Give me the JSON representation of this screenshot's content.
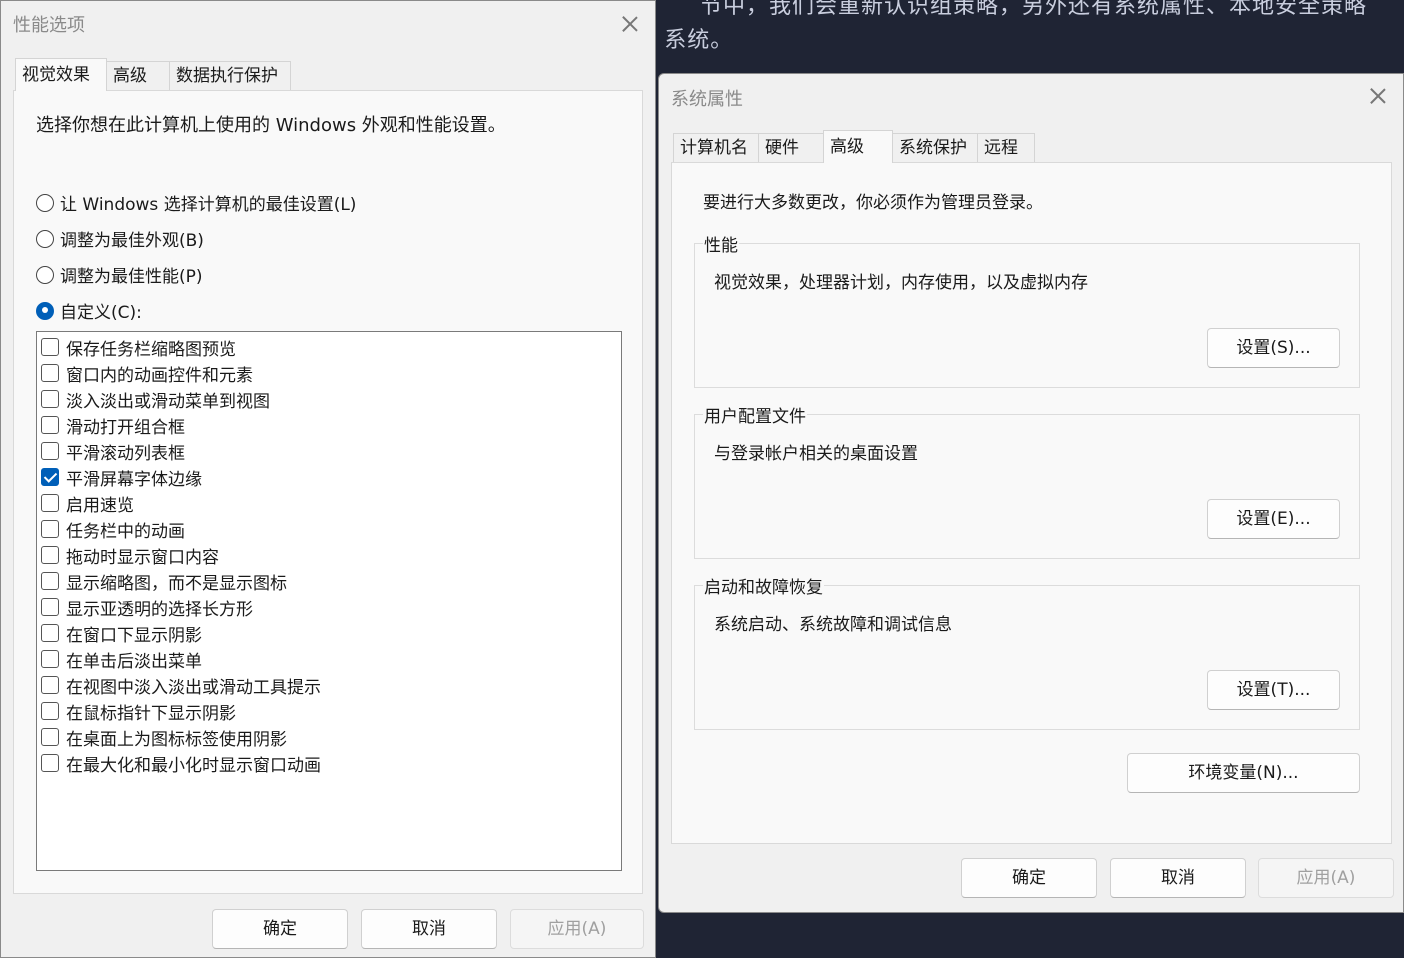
{
  "background": {
    "line1": "节中，我们会重新认识组策略，另外还有系统属性、本地安全策略",
    "line2": "s 系统。"
  },
  "perf": {
    "title": "性能选项",
    "tabs": [
      "视觉效果",
      "高级",
      "数据执行保护"
    ],
    "description": "选择你想在此计算机上使用的 Windows 外观和性能设置。",
    "radios": [
      {
        "label": "让 Windows 选择计算机的最佳设置(L)",
        "checked": false
      },
      {
        "label": "调整为最佳外观(B)",
        "checked": false
      },
      {
        "label": "调整为最佳性能(P)",
        "checked": false
      },
      {
        "label": "自定义(C):",
        "checked": true
      }
    ],
    "options": [
      {
        "label": "保存任务栏缩略图预览",
        "checked": false
      },
      {
        "label": "窗口内的动画控件和元素",
        "checked": false
      },
      {
        "label": "淡入淡出或滑动菜单到视图",
        "checked": false
      },
      {
        "label": "滑动打开组合框",
        "checked": false
      },
      {
        "label": "平滑滚动列表框",
        "checked": false
      },
      {
        "label": "平滑屏幕字体边缘",
        "checked": true
      },
      {
        "label": "启用速览",
        "checked": false
      },
      {
        "label": "任务栏中的动画",
        "checked": false
      },
      {
        "label": "拖动时显示窗口内容",
        "checked": false
      },
      {
        "label": "显示缩略图，而不是显示图标",
        "checked": false
      },
      {
        "label": "显示亚透明的选择长方形",
        "checked": false
      },
      {
        "label": "在窗口下显示阴影",
        "checked": false
      },
      {
        "label": "在单击后淡出菜单",
        "checked": false
      },
      {
        "label": "在视图中淡入淡出或滑动工具提示",
        "checked": false
      },
      {
        "label": "在鼠标指针下显示阴影",
        "checked": false
      },
      {
        "label": "在桌面上为图标标签使用阴影",
        "checked": false
      },
      {
        "label": "在最大化和最小化时显示窗口动画",
        "checked": false
      }
    ],
    "ok": "确定",
    "cancel": "取消",
    "apply": "应用(A)"
  },
  "sys": {
    "title": "系统属性",
    "tabs": [
      "计算机名",
      "硬件",
      "高级",
      "系统保护",
      "远程"
    ],
    "admin_note": "要进行大多数更改，你必须作为管理员登录。",
    "groups": [
      {
        "title": "性能",
        "desc": "视觉效果，处理器计划，内存使用，以及虚拟内存",
        "button": "设置(S)..."
      },
      {
        "title": "用户配置文件",
        "desc": "与登录帐户相关的桌面设置",
        "button": "设置(E)..."
      },
      {
        "title": "启动和故障恢复",
        "desc": "系统启动、系统故障和调试信息",
        "button": "设置(T)..."
      }
    ],
    "env_button": "环境变量(N)...",
    "ok": "确定",
    "cancel": "取消",
    "apply": "应用(A)"
  }
}
